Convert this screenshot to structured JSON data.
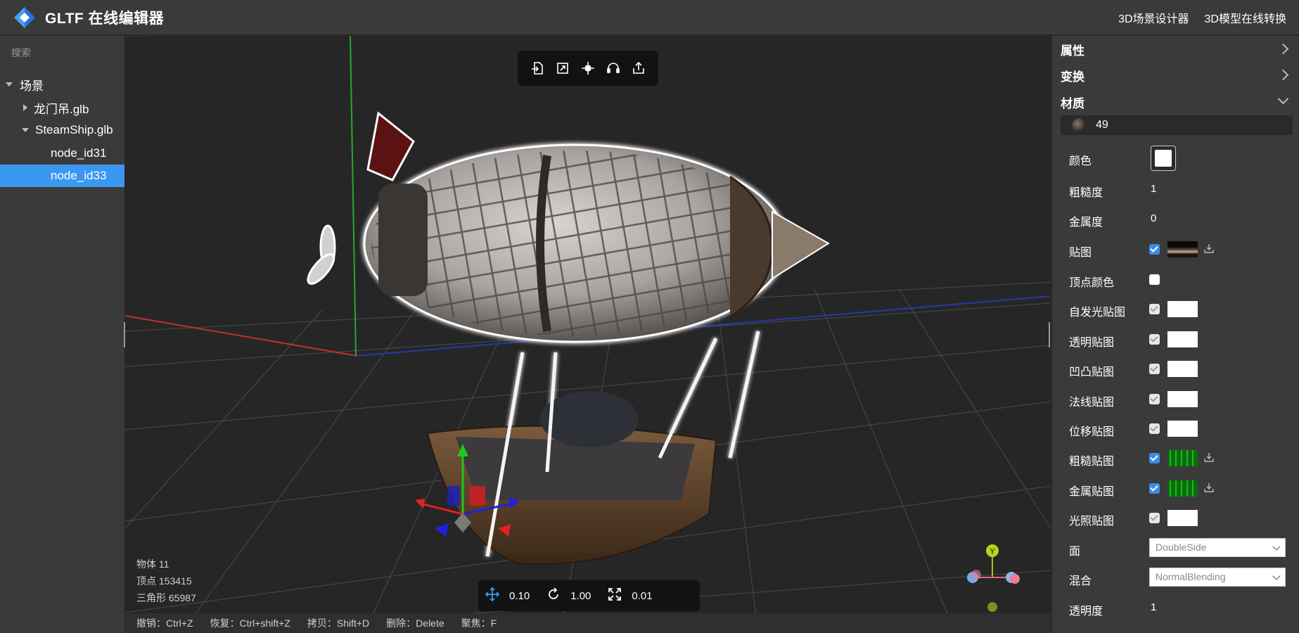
{
  "header": {
    "title": "GLTF 在线编辑器",
    "links": [
      "3D场景设计器",
      "3D模型在线转换"
    ]
  },
  "left_panel": {
    "search_label": "搜索",
    "tree": [
      {
        "label": "场景",
        "expanded": true
      },
      {
        "label": "龙门吊.glb",
        "expanded": false
      },
      {
        "label": "SteamShip.glb",
        "expanded": true
      },
      {
        "label": "node_id31"
      },
      {
        "label": "node_id33",
        "selected": true
      }
    ]
  },
  "viewport": {
    "toolbar_icons": [
      "import-icon",
      "export-icon",
      "center-icon",
      "headset-icon",
      "share-icon"
    ],
    "stats": {
      "objects": "物体 11",
      "vertices": "顶点 153415",
      "triangles": "三角形 65987"
    },
    "transform_steps": {
      "translate": "0.10",
      "rotate": "1.00",
      "scale": "0.01"
    },
    "axis_gizmo_label": "Y",
    "shortcuts": [
      "撤销：Ctrl+Z",
      "恢复：Ctrl+shift+Z",
      "拷贝：Shift+D",
      "删除：Delete",
      "聚焦：F"
    ]
  },
  "right_panel": {
    "sections": [
      "属性",
      "变换",
      "材质"
    ],
    "material": {
      "name": "49",
      "props": {
        "color_label": "颜色",
        "roughness_label": "粗糙度",
        "roughness": "1",
        "metalness_label": "金属度",
        "metalness": "0",
        "map_label": "贴图",
        "vertex_colors_label": "顶点颜色",
        "emissive_map_label": "自发光贴图",
        "alpha_map_label": "透明贴图",
        "bump_map_label": "凹凸贴图",
        "normal_map_label": "法线贴图",
        "displacement_map_label": "位移贴图",
        "roughness_map_label": "粗糙贴图",
        "metalness_map_label": "金属贴图",
        "light_map_label": "光照贴图",
        "side_label": "面",
        "side": "DoubleSide",
        "blending_label": "混合",
        "blending": "NormalBlending",
        "opacity_label": "透明度",
        "opacity": "1"
      }
    }
  },
  "colors": {
    "accent": "#3a98f0",
    "panel": "#3a3a3a",
    "viewport": "#262626"
  }
}
